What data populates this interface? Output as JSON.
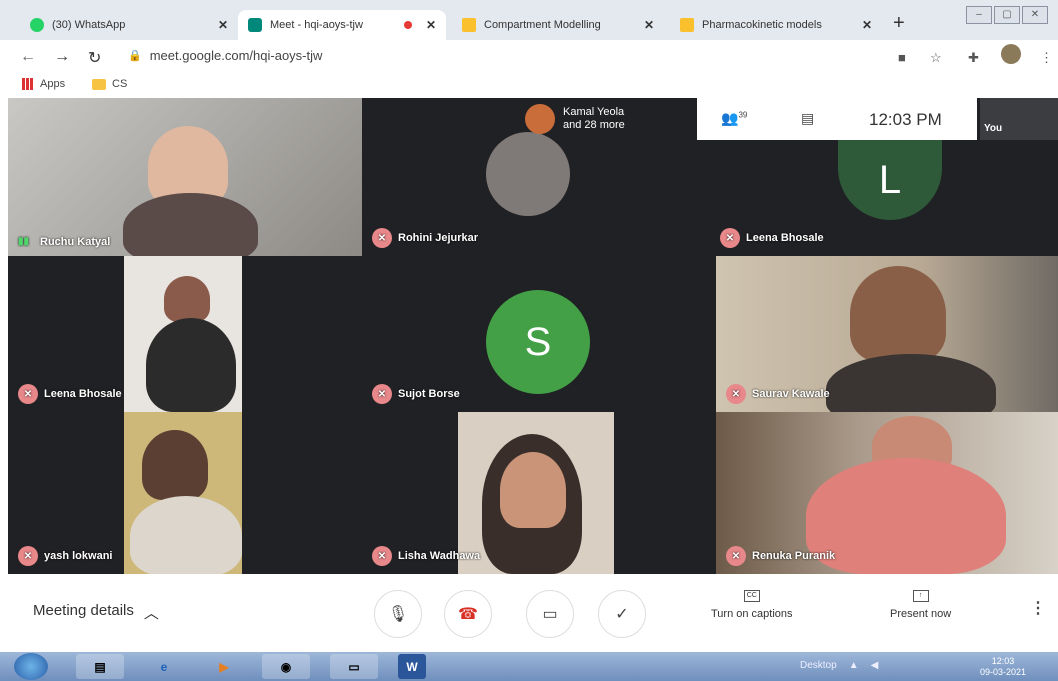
{
  "browser": {
    "tabs": [
      {
        "label": "(30) WhatsApp",
        "active": false
      },
      {
        "label": "Meet - hqi-aoys-tjw",
        "active": true
      },
      {
        "label": "Compartment Modelling",
        "active": false
      },
      {
        "label": "Pharmacokinetic models",
        "active": false
      }
    ],
    "url": "meet.google.com/hqi-aoys-tjw",
    "bookmarks": [
      {
        "label": "Apps"
      },
      {
        "label": "CS"
      }
    ]
  },
  "meet": {
    "others_label_1": "Kamal Yeola",
    "others_label_2": "and 28 more",
    "participant_count": "39",
    "time": "12:03 PM",
    "self_label": "You",
    "tiles": [
      {
        "name": "Ruchu Katyal"
      },
      {
        "name": "Rohini Jejurkar"
      },
      {
        "name": "Leena Bhosale"
      },
      {
        "name": "Leena Bhosale"
      },
      {
        "name": "Sujot Borse"
      },
      {
        "name": "Saurav Kawale"
      },
      {
        "name": "yash lokwani"
      },
      {
        "name": "Lisha Wadhawa"
      },
      {
        "name": "Renuka Puranik"
      }
    ],
    "avatar_letters": {
      "leena": "L",
      "sujot": "S"
    }
  },
  "controls": {
    "meeting_details": "Meeting details",
    "captions": "Turn on captions",
    "present": "Present now",
    "captions_icon": "CC"
  },
  "taskbar": {
    "word_label": "W",
    "desktop_label": "Desktop",
    "clock_time": "12:03",
    "clock_date": "09-03-2021"
  },
  "colors": {
    "meet_bg": "#202124",
    "avatar_green": "#43a047",
    "avatar_dark_green": "#2e5a3a",
    "end_call_red": "#d93025"
  }
}
